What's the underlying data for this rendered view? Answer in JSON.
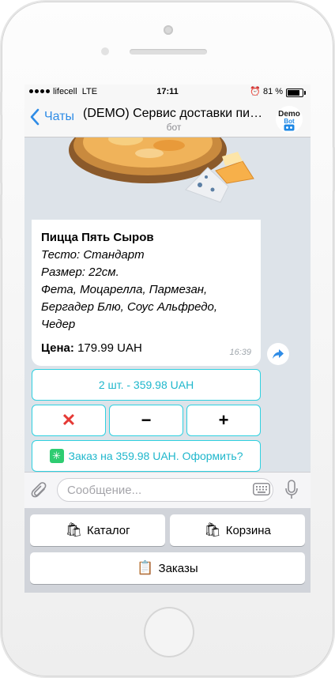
{
  "status": {
    "carrier": "lifecell",
    "network": "LTE",
    "time": "17:11",
    "battery": "81 %",
    "battery_level": 0.81
  },
  "nav": {
    "back_label": "Чаты",
    "title": "(DEMO) Сервис доставки пиццы",
    "subtitle": "бот",
    "avatar_line1": "Demo",
    "avatar_line2": "Bot"
  },
  "message": {
    "name": "Пицца Пять Сыров",
    "lines": [
      "Тесто: Стандарт",
      "Размер: 22см.",
      "Фета, Моцарелла, Пармезан,",
      "Бергадер Блю, Соус Альфредо,",
      "Чедер"
    ],
    "price_label": "Цена:",
    "price_value": "179.99 UAH",
    "time": "16:39"
  },
  "inline": {
    "quantity": "2 шт. - 359.98 UAH",
    "remove": "✕",
    "minus": "−",
    "plus": "+",
    "checkout": "Заказ на 359.98 UAH. Оформить?",
    "checkout_icon": "✳"
  },
  "input": {
    "placeholder": "Сообщение..."
  },
  "keyboard": {
    "catalog": "Каталог",
    "catalog_icon": "🛍",
    "cart": "Корзина",
    "cart_icon": "🛍",
    "orders": "Заказы",
    "orders_icon": "📋"
  },
  "colors": {
    "accent": "#2f8ce6",
    "inline_border": "#2fd0e0",
    "inline_text": "#1fb7cc",
    "remove": "#e53935",
    "checkout_icon_bg": "#2ecc71"
  }
}
